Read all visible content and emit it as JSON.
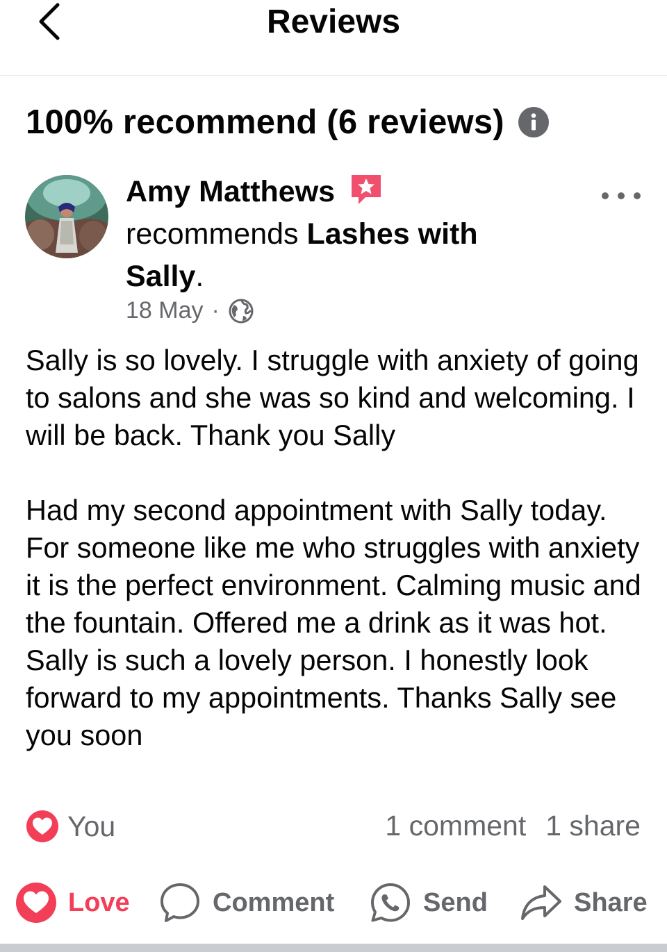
{
  "header": {
    "title": "Reviews",
    "back_icon": "chevron-left-icon"
  },
  "summary": {
    "text": "100% recommend (6 reviews)",
    "info_icon": "info-icon"
  },
  "review": {
    "author": "Amy Matthews",
    "badge_icon": "top-fan-star-badge-icon",
    "verb": "recommends",
    "page_name": "Lashes with Sally",
    "period": ".",
    "date": "18 May",
    "separator": "·",
    "privacy_icon": "globe-icon",
    "more_icon": "more-horizontal-icon",
    "paragraphs": [
      "Sally is so lovely. I struggle with anxiety of going to salons and she was so kind and welcoming. I will be back. Thank you Sally",
      "Had my second appointment with Sally today. For someone like me who struggles with anxiety it is the perfect environment. Calming music and the fountain. Offered me a drink as it was hot. Sally is such a lovely person. I honestly look forward to my appointments. Thanks Sally see you soon"
    ],
    "reactions": {
      "icon": "love-reaction-icon",
      "label": "You"
    },
    "comment_count": "1 comment",
    "share_count": "1 share"
  },
  "actions": [
    {
      "label": "Love",
      "icon": "heart-icon",
      "active": true
    },
    {
      "label": "Comment",
      "icon": "comment-bubble-icon"
    },
    {
      "label": "Send",
      "icon": "whatsapp-icon"
    },
    {
      "label": "Share",
      "icon": "share-arrow-icon"
    }
  ],
  "colors": {
    "love_red": "#f33e58",
    "secondary_text": "#65676b",
    "primary_text": "#050505",
    "badge_pink": "#f0506e"
  }
}
